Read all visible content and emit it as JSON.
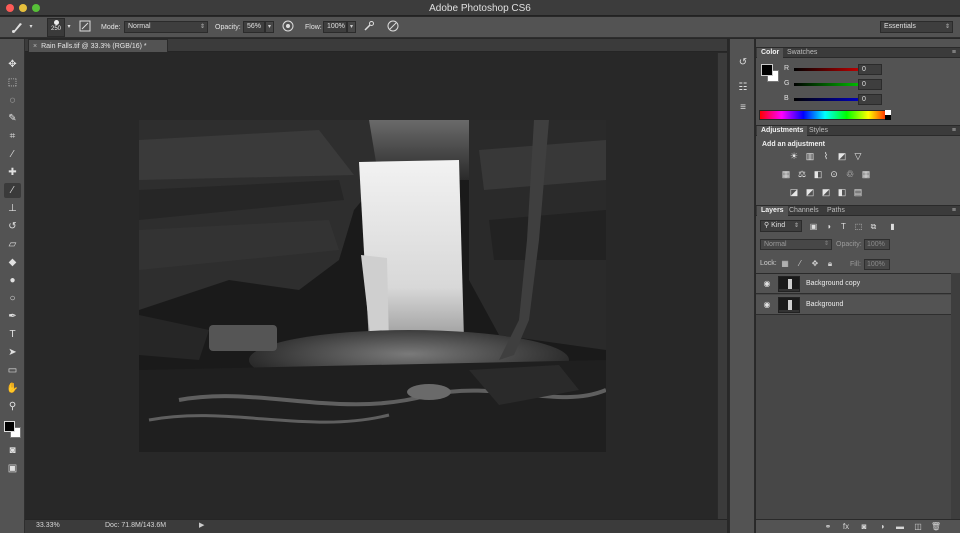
{
  "app": {
    "title": "Adobe Photoshop CS6"
  },
  "options_bar": {
    "brush_size": "250",
    "mode_label": "Mode:",
    "mode_value": "Normal",
    "opacity_label": "Opacity:",
    "opacity_value": "56%",
    "flow_label": "Flow:",
    "flow_value": "100%",
    "workspace": "Essentials"
  },
  "document": {
    "tab_title": "Rain Falls.tif @ 33.3% (RGB/16) *",
    "close_glyph": "×"
  },
  "status_bar": {
    "zoom": "33.33%",
    "doc_size": "Doc: 71.8M/143.6M"
  },
  "color_panel": {
    "tabs": [
      "Color",
      "Swatches"
    ],
    "channels": [
      {
        "label": "R",
        "value": "0",
        "color": "#e02020"
      },
      {
        "label": "G",
        "value": "0",
        "color": "#20c020"
      },
      {
        "label": "B",
        "value": "0",
        "color": "#2040e0"
      }
    ],
    "foreground": "#000000",
    "background": "#ffffff"
  },
  "adjustments_panel": {
    "tabs": [
      "Adjustments",
      "Styles"
    ],
    "heading": "Add an adjustment"
  },
  "layers_panel": {
    "tabs": [
      "Layers",
      "Channels",
      "Paths"
    ],
    "filter_kind": "Kind",
    "blend_mode": "Normal",
    "opacity_label": "Opacity:",
    "opacity_value": "100%",
    "lock_label": "Lock:",
    "fill_label": "Fill:",
    "fill_value": "100%",
    "layers": [
      {
        "name": "Background copy"
      },
      {
        "name": "Background"
      }
    ]
  }
}
